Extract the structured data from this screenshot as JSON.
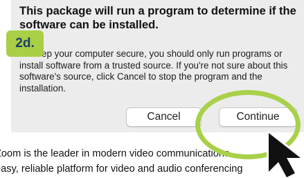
{
  "dialog": {
    "title": "This package will run a program to determine if the software can be installed.",
    "body": "To keep your computer secure, you should only run programs or install software from a trusted source. If you're not sure about this software's source, click Cancel to stop the program and the installation.",
    "buttons": {
      "cancel_label": "Cancel",
      "continue_label": "Continue"
    }
  },
  "page": {
    "line1": "Zoom is the leader in modern video communications",
    "line2": "easy, reliable platform for video and audio conferencing"
  },
  "annotation": {
    "step_label": "2d.",
    "badge_color": "#a8cf45",
    "highlight_color": "#a9d04a",
    "cursor_icon": "arrow-cursor-icon"
  }
}
